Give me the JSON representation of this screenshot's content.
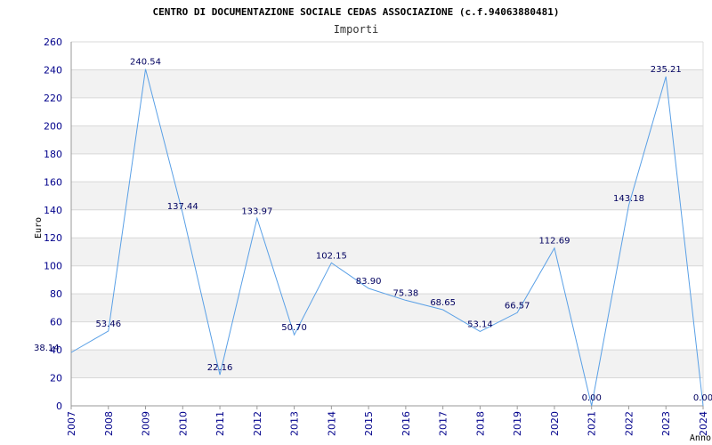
{
  "chart_data": {
    "type": "line",
    "title": "CENTRO DI DOCUMENTAZIONE SOCIALE CEDAS ASSOCIAZIONE (c.f.94063880481)",
    "subtitle": "Importi",
    "xlabel": "Anno",
    "ylabel": "Euro",
    "categories": [
      "2007",
      "2008",
      "2009",
      "2010",
      "2011",
      "2012",
      "2013",
      "2014",
      "2015",
      "2016",
      "2017",
      "2018",
      "2019",
      "2020",
      "2021",
      "2022",
      "2023",
      "2024"
    ],
    "values": [
      38.14,
      53.46,
      240.54,
      137.44,
      22.16,
      133.97,
      50.7,
      102.15,
      83.9,
      75.38,
      68.65,
      53.14,
      66.57,
      112.69,
      0.0,
      143.18,
      235.21,
      0.0
    ],
    "value_labels": [
      "38.14",
      "53.46",
      "240.54",
      "137.44",
      "22.16",
      "133.97",
      "50.70",
      "102.15",
      "83.90",
      "75.38",
      "68.65",
      "53.14",
      "66.57",
      "112.69",
      "0.00",
      "143.18",
      "235.21",
      "0.00"
    ],
    "ylim": [
      0,
      260
    ],
    "yticks": [
      0,
      20,
      40,
      60,
      80,
      100,
      120,
      140,
      160,
      180,
      200,
      220,
      240,
      260
    ],
    "grid": true,
    "colors": {
      "line": "#5aa0e6",
      "band": "#f2f2f2",
      "grid": "#d8d8d8",
      "ticks": "#00008b",
      "labels": "#00005f"
    }
  }
}
